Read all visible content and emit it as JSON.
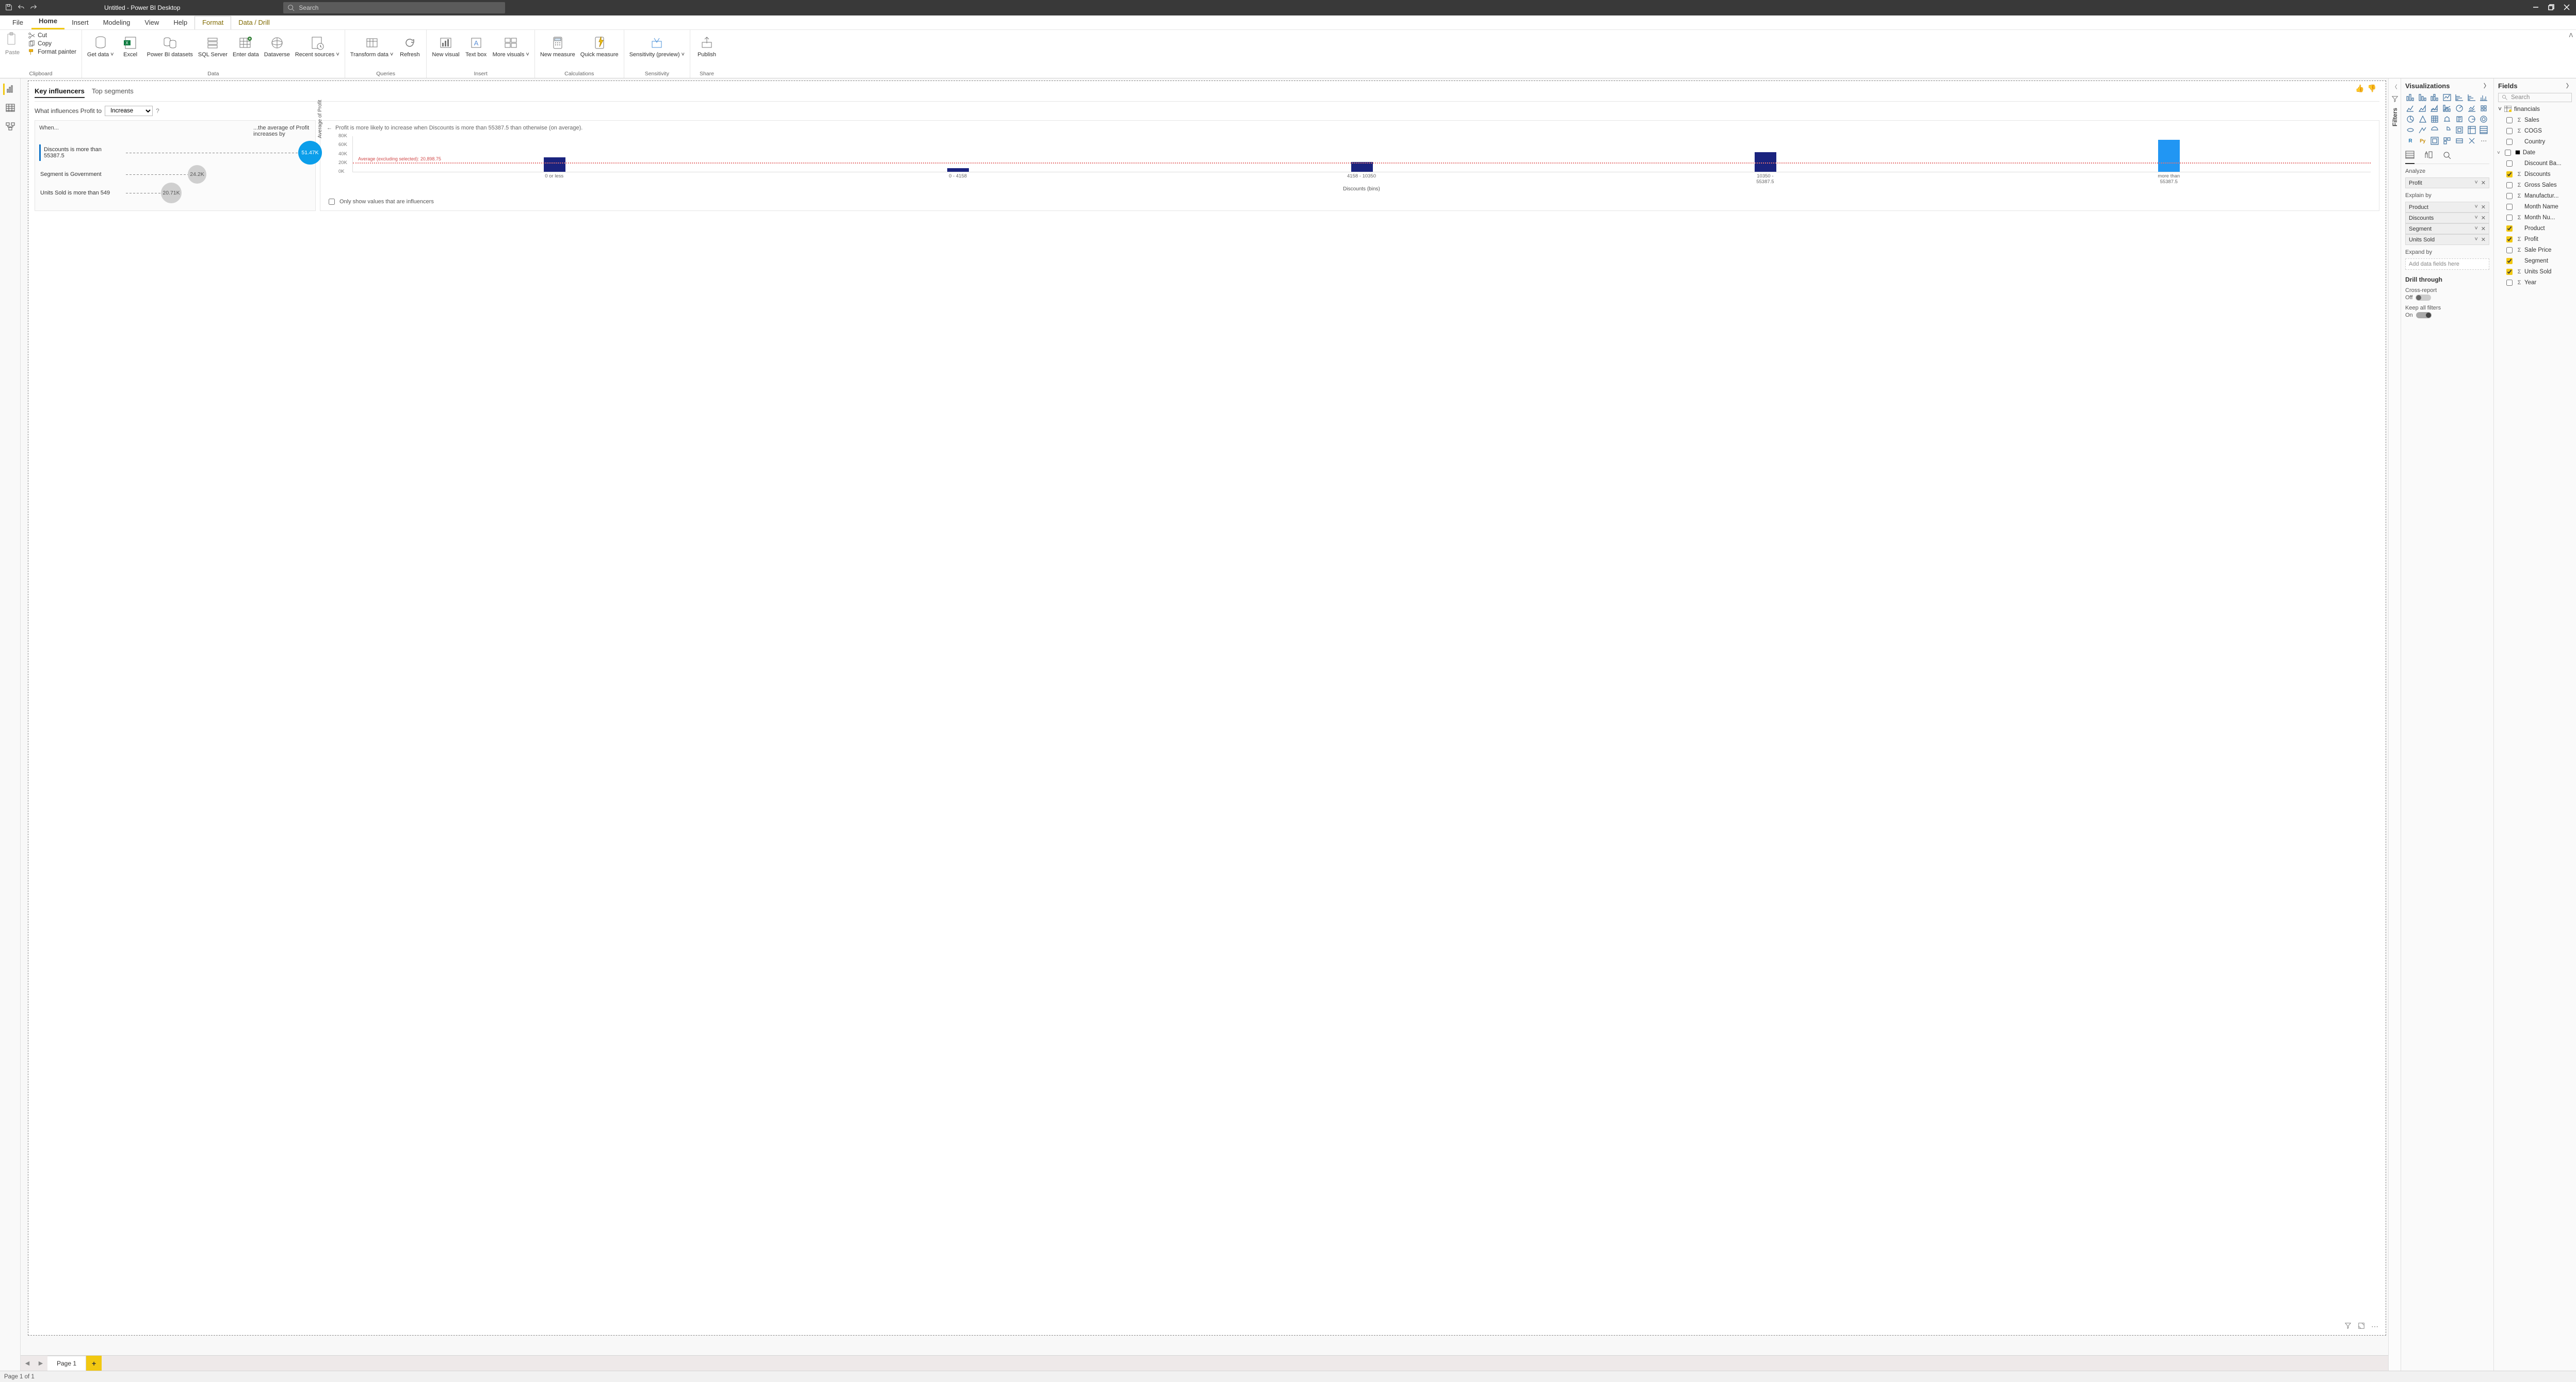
{
  "app": {
    "title": "Untitled - Power BI Desktop",
    "search_placeholder": "Search"
  },
  "ribbon_tabs": {
    "file": "File",
    "home": "Home",
    "insert": "Insert",
    "modeling": "Modeling",
    "view": "View",
    "help": "Help",
    "format": "Format",
    "datadrill": "Data / Drill"
  },
  "ribbon_groups": {
    "clipboard": "Clipboard",
    "data": "Data",
    "queries": "Queries",
    "insert": "Insert",
    "calculations": "Calculations",
    "sensitivity": "Sensitivity",
    "share": "Share"
  },
  "ribbon_buttons": {
    "paste": "Paste",
    "cut": "Cut",
    "copy": "Copy",
    "format_painter": "Format painter",
    "get_data": "Get data ˅",
    "excel": "Excel",
    "pbi_datasets": "Power BI datasets",
    "sql_server": "SQL Server",
    "enter_data": "Enter data",
    "dataverse": "Dataverse",
    "recent_sources": "Recent sources ˅",
    "transform": "Transform data ˅",
    "refresh": "Refresh",
    "new_visual": "New visual",
    "text_box": "Text box",
    "more_visuals": "More visuals ˅",
    "new_measure": "New measure",
    "quick_measure": "Quick measure",
    "sensitivity": "Sensitivity (preview) ˅",
    "publish": "Publish"
  },
  "filters_rail": {
    "label": "Filters"
  },
  "vis_pane": {
    "title": "Visualizations",
    "sections": {
      "analyze": "Analyze",
      "explain_by": "Explain by",
      "expand_by": "Expand by"
    },
    "wells": {
      "analyze": "Profit",
      "explain_by": [
        "Product",
        "Discounts",
        "Segment",
        "Units Sold"
      ],
      "expand_placeholder": "Add data fields here"
    },
    "drill": {
      "title": "Drill through",
      "cross_report": "Cross-report",
      "cross_report_state": "Off",
      "keep_filters": "Keep all filters",
      "keep_filters_state": "On"
    }
  },
  "fields_pane": {
    "title": "Fields",
    "search_placeholder": "Search",
    "table": "financials",
    "fields": [
      {
        "name": "Sales",
        "checked": false,
        "sigma": true
      },
      {
        "name": "COGS",
        "checked": false,
        "sigma": true
      },
      {
        "name": "Country",
        "checked": false,
        "sigma": false
      },
      {
        "name": "Date",
        "checked": false,
        "sigma": false,
        "date": true,
        "expandable": true
      },
      {
        "name": "Discount Ba...",
        "checked": false,
        "sigma": false
      },
      {
        "name": "Discounts",
        "checked": true,
        "sigma": true
      },
      {
        "name": "Gross Sales",
        "checked": false,
        "sigma": true
      },
      {
        "name": "Manufactur...",
        "checked": false,
        "sigma": true
      },
      {
        "name": "Month Name",
        "checked": false,
        "sigma": false
      },
      {
        "name": "Month Nu...",
        "checked": false,
        "sigma": true
      },
      {
        "name": "Product",
        "checked": true,
        "sigma": false
      },
      {
        "name": "Profit",
        "checked": true,
        "sigma": true
      },
      {
        "name": "Sale Price",
        "checked": false,
        "sigma": true
      },
      {
        "name": "Segment",
        "checked": true,
        "sigma": false
      },
      {
        "name": "Units Sold",
        "checked": true,
        "sigma": true
      },
      {
        "name": "Year",
        "checked": false,
        "sigma": true
      }
    ]
  },
  "visual": {
    "tabs": {
      "key_influencers": "Key influencers",
      "top_segments": "Top segments"
    },
    "question_prefix": "What influences Profit to",
    "question_dropdown": "Increase",
    "question_mark": "?",
    "left_header_when": "When...",
    "left_header_by": "...the average of Profit increases by",
    "influencers": [
      {
        "label": "Discounts is more than 55387.5",
        "value": "51.47K",
        "selected": true,
        "size": 46,
        "pos": 540
      },
      {
        "label": "Segment is Government",
        "value": "24.2K",
        "selected": false,
        "size": 36,
        "pos": 290
      },
      {
        "label": "Units Sold is more than 549",
        "value": "20.71K",
        "selected": false,
        "size": 40,
        "pos": 240
      }
    ],
    "right_desc": "Profit is more likely to increase when Discounts is more than 55387.5 than otherwise (on average).",
    "only_influencers": "Only show values that are influencers"
  },
  "chart_data": {
    "type": "bar",
    "title": "",
    "ylabel": "Average of Profit",
    "xlabel": "Discounts (bins)",
    "ylim": [
      0,
      80000
    ],
    "yticks": [
      "0K",
      "20K",
      "40K",
      "60K",
      "80K"
    ],
    "categories": [
      "0 or less",
      "0 - 4158",
      "4158 - 10350",
      "10350 - 55387.5",
      "more than 55387.5"
    ],
    "values": [
      32500,
      8700,
      22400,
      44000,
      72400
    ],
    "highlight_index": 4,
    "avg_excl_selected": 20898.75,
    "avg_label": "Average (excluding selected): 20,898.75"
  },
  "pagebar": {
    "page": "Page 1"
  },
  "status": {
    "text": "Page 1 of 1"
  }
}
